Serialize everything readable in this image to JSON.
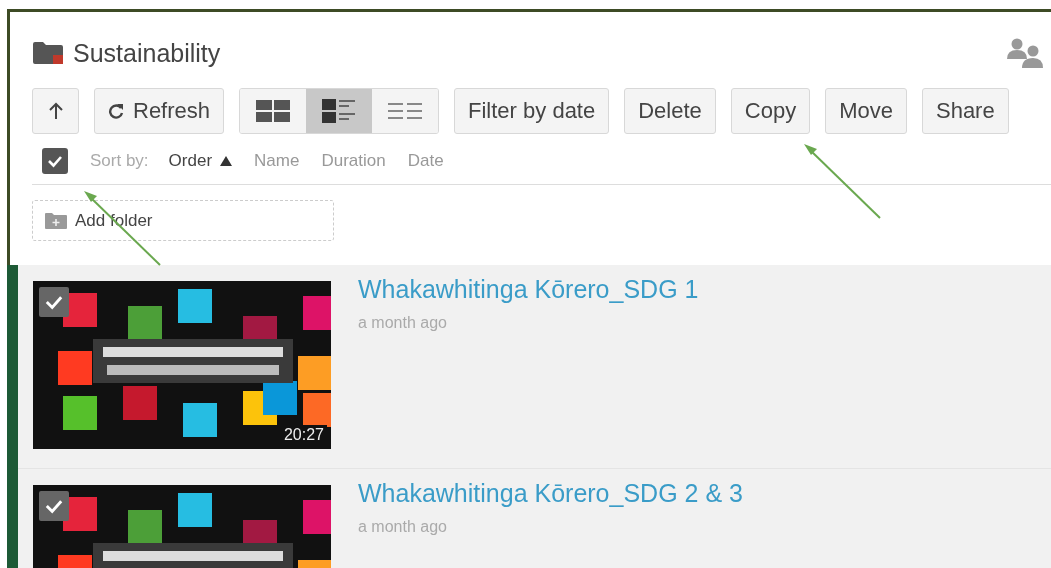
{
  "folder": {
    "title": "Sustainability"
  },
  "toolbar": {
    "up": {
      "kind": "up"
    },
    "refresh": {
      "label": "Refresh"
    },
    "views": [
      {
        "kind": "grid",
        "selected": false
      },
      {
        "kind": "list-thumbs",
        "selected": true
      },
      {
        "kind": "list",
        "selected": false
      }
    ],
    "actions": [
      {
        "label": "Filter by date"
      },
      {
        "label": "Delete"
      },
      {
        "label": "Copy"
      },
      {
        "label": "Move"
      },
      {
        "label": "Share"
      }
    ]
  },
  "sort": {
    "select_all_checked": true,
    "label": "Sort by:",
    "options": [
      {
        "label": "Order",
        "selected": true
      },
      {
        "label": "Name",
        "selected": false
      },
      {
        "label": "Duration",
        "selected": false
      },
      {
        "label": "Date",
        "selected": false
      }
    ]
  },
  "add_folder": {
    "label": "Add folder"
  },
  "videos": [
    {
      "title": "Whakawhitinga Kōrero_SDG 1",
      "age": "a month ago",
      "duration": "20:27",
      "checked": true
    },
    {
      "title": "Whakawhitinga Kōrero_SDG 2 & 3",
      "age": "a month ago",
      "checked": true
    }
  ]
}
